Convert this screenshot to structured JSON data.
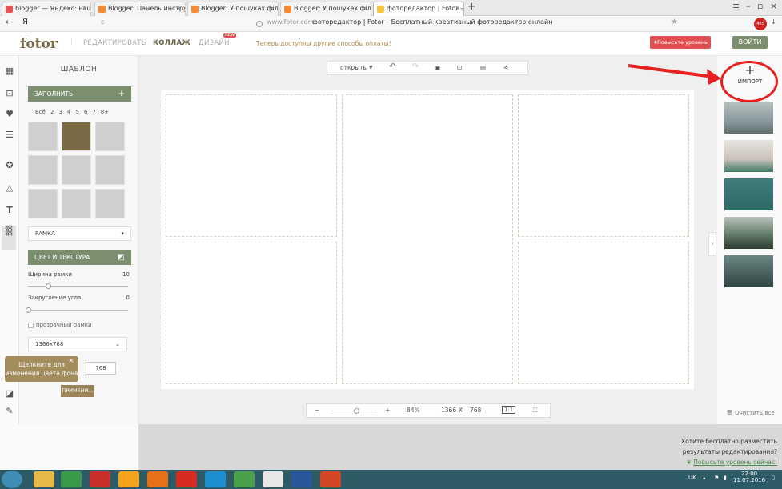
{
  "browser": {
    "tabs": [
      {
        "label": "blogger — Яндекс: нашлос",
        "color": "#e45454"
      },
      {
        "label": "Blogger: Панель инструмен",
        "color": "#f48b34"
      },
      {
        "label": "Blogger: У пошуках філосс",
        "color": "#f48b34"
      },
      {
        "label": "Blogger: У пошуках філосо",
        "color": "#f48b34"
      },
      {
        "label": "фоторедактор | Fotor – Б",
        "color": "#f5c642"
      }
    ],
    "new_tab_glyph": "+",
    "address_back": "←",
    "address_ya": "Я",
    "address_url": "www.fotor.com",
    "address_title": "фоторедактор | Fotor – Бесплатный креативный фоторедактор онлайн",
    "star": "★",
    "badge_count": "485"
  },
  "header": {
    "logo": "fotor",
    "nav": [
      "РЕДАКТИРОВАТЬ",
      "КОЛЛАЖ",
      "ДИЗАЙН"
    ],
    "new_badge": "NEW",
    "upsell": "Теперь доступны другие способы оплаты!",
    "upgrade_button": "Повысьте уровень",
    "login_button": "ВОЙТИ"
  },
  "left_panel": {
    "title": "ШАБЛОН",
    "fill_button": "ЗАПОЛНИТЬ",
    "counts": [
      "Всё",
      "2",
      "3",
      "4",
      "5",
      "6",
      "7",
      "8+"
    ],
    "frame_select": "РАМКА",
    "color_texture_button": "ЦВЕТ И ТЕКСТУРА",
    "border_width_label": "Ширина рамки",
    "border_width_value": "10",
    "border_width": 0.2,
    "corner_label": "Закругление угла",
    "corner_value": "0",
    "corner": 0,
    "transparent_label": "прозрачный рамки",
    "size_select": "1366x768",
    "height_value": "768",
    "apply_button": "ПРИМЕНИ...",
    "tooltip": "Щелкните для изменения цвета фона"
  },
  "toolbar": {
    "open_label": "открыть"
  },
  "zoom": {
    "minus": "−",
    "plus": "+",
    "percent": "84%",
    "width": "1366",
    "x": "X",
    "height": "768",
    "ratio": "1:1",
    "level": 0.55
  },
  "right_panel": {
    "import_label": "ИМПОРТ",
    "import_plus": "+",
    "clear_label": "Очистить все"
  },
  "notification": {
    "line1": "Хотите бесплатно разместить",
    "line2": "результаты редактирования?",
    "link": "Повысьте уровень сейчас!"
  },
  "taskbar": {
    "lang": "UK",
    "time": "22:00",
    "date": "11.07.2016"
  }
}
